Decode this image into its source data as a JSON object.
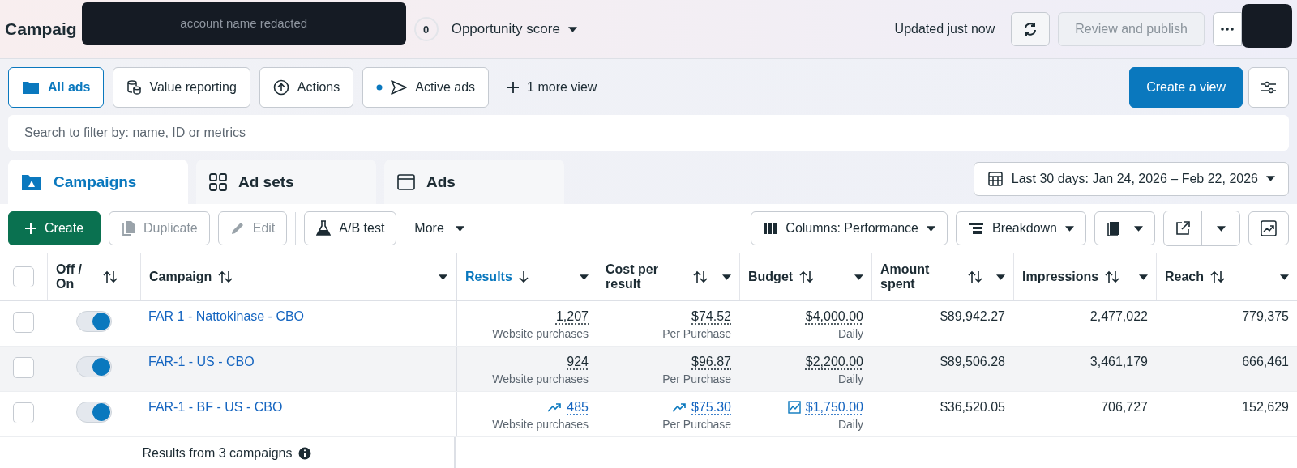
{
  "header": {
    "title": "Campaig",
    "redaction": "account name redacted",
    "score": "0",
    "score_label": "Opportunity score",
    "updated": "Updated just now",
    "review": {
      "label": "Review and publish",
      "disabled": true
    }
  },
  "views": [
    {
      "label": "All ads",
      "selected": true
    },
    {
      "label": "Value reporting",
      "selected": false
    },
    {
      "label": "Actions",
      "selected": false
    },
    {
      "label": "Active ads",
      "selected": false
    }
  ],
  "more_view": "1 more view",
  "create_view": "Create a view",
  "search": {
    "placeholder": "Search to filter by: name, ID or metrics"
  },
  "level_tabs": [
    {
      "label": "Campaigns",
      "selected": true
    },
    {
      "label": "Ad sets",
      "selected": false
    },
    {
      "label": "Ads",
      "selected": false
    }
  ],
  "date_range": "Last 30 days: Jan 24, 2026 – Feb 22, 2026",
  "toolbar": {
    "create": "Create",
    "duplicate": {
      "label": "Duplicate",
      "disabled": true
    },
    "edit": {
      "label": "Edit",
      "disabled": true
    },
    "ab_test": "A/B test",
    "more": "More",
    "columns": "Columns: Performance",
    "breakdown": "Breakdown"
  },
  "table": {
    "all_checked": false,
    "columns": [
      {
        "label": "Off / On",
        "active": false
      },
      {
        "label": "Campaign",
        "active": false
      },
      {
        "label": "Results",
        "active": true
      },
      {
        "label": "Cost per result",
        "active": false
      },
      {
        "label": "Budget",
        "active": false
      },
      {
        "label": "Amount spent",
        "active": false
      },
      {
        "label": "Impressions",
        "active": false
      },
      {
        "label": "Reach",
        "active": false
      }
    ],
    "rows": [
      {
        "checked": false,
        "on": true,
        "campaign": "FAR 1 - Nattokinase - CBO",
        "results": {
          "value": "1,207",
          "sub": "Website purchases",
          "trend": false
        },
        "cost": {
          "value": "$74.52",
          "sub": "Per Purchase",
          "trend": false
        },
        "budget": {
          "value": "$4,000.00",
          "sub": "Daily",
          "trend": false
        },
        "amount": "$89,942.27",
        "impressions": "2,477,022",
        "reach": "779,375"
      },
      {
        "checked": false,
        "on": true,
        "campaign": "FAR-1 - US - CBO",
        "results": {
          "value": "924",
          "sub": "Website purchases",
          "trend": false
        },
        "cost": {
          "value": "$96.87",
          "sub": "Per Purchase",
          "trend": false
        },
        "budget": {
          "value": "$2,200.00",
          "sub": "Daily",
          "trend": false
        },
        "amount": "$89,506.28",
        "impressions": "3,461,179",
        "reach": "666,461"
      },
      {
        "checked": false,
        "on": true,
        "campaign": "FAR-1 - BF - US - CBO",
        "results": {
          "value": "485",
          "sub": "Website purchases",
          "trend": true
        },
        "cost": {
          "value": "$75.30",
          "sub": "Per Purchase",
          "trend": true
        },
        "budget": {
          "value": "$1,750.00",
          "sub": "Daily",
          "trend": true
        },
        "amount": "$36,520.05",
        "impressions": "706,727",
        "reach": "152,629"
      }
    ],
    "footer": "Results from 3 campaigns"
  }
}
